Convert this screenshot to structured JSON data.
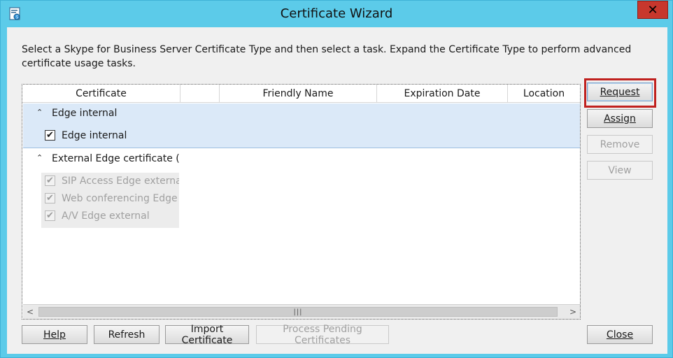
{
  "window": {
    "title": "Certificate Wizard",
    "close_glyph": "✕",
    "app_icon": "certificate-wizard-app-icon"
  },
  "instructions": "Select a Skype for Business Server Certificate Type and then select a task. Expand the Certificate Type to perform advanced certificate usage tasks.",
  "grid": {
    "columns": [
      "Certificate",
      "",
      "Friendly Name",
      "Expiration Date",
      "Location"
    ],
    "groups": [
      {
        "label": "Edge internal",
        "expanded": true,
        "children": [
          {
            "label": "Edge internal",
            "checked": true,
            "enabled": true
          }
        ]
      },
      {
        "label": "External Edge certificate (pu",
        "expanded": true,
        "children": [
          {
            "label": "SIP Access Edge external",
            "checked": true,
            "enabled": false
          },
          {
            "label": "Web conferencing Edge e",
            "checked": true,
            "enabled": false
          },
          {
            "label": "A/V Edge external",
            "checked": true,
            "enabled": false
          }
        ]
      }
    ],
    "scroll": {
      "left_arrow": "<",
      "right_arrow": ">",
      "thumb_grip": "|||"
    }
  },
  "side_buttons": {
    "request": "Request",
    "assign": "Assign",
    "remove": "Remove",
    "view": "View"
  },
  "bottom_buttons": {
    "help": "Help",
    "refresh": "Refresh",
    "import": "Import Certificate",
    "process_pending": "Process Pending Certificates",
    "close": "Close"
  },
  "glyphs": {
    "caret_up": "⌃",
    "check": "✔"
  },
  "colors": {
    "title_bar": "#5ccbe9",
    "close_button": "#c7372d",
    "selection": "#dbe9f8",
    "highlight_box": "#c0211f"
  }
}
